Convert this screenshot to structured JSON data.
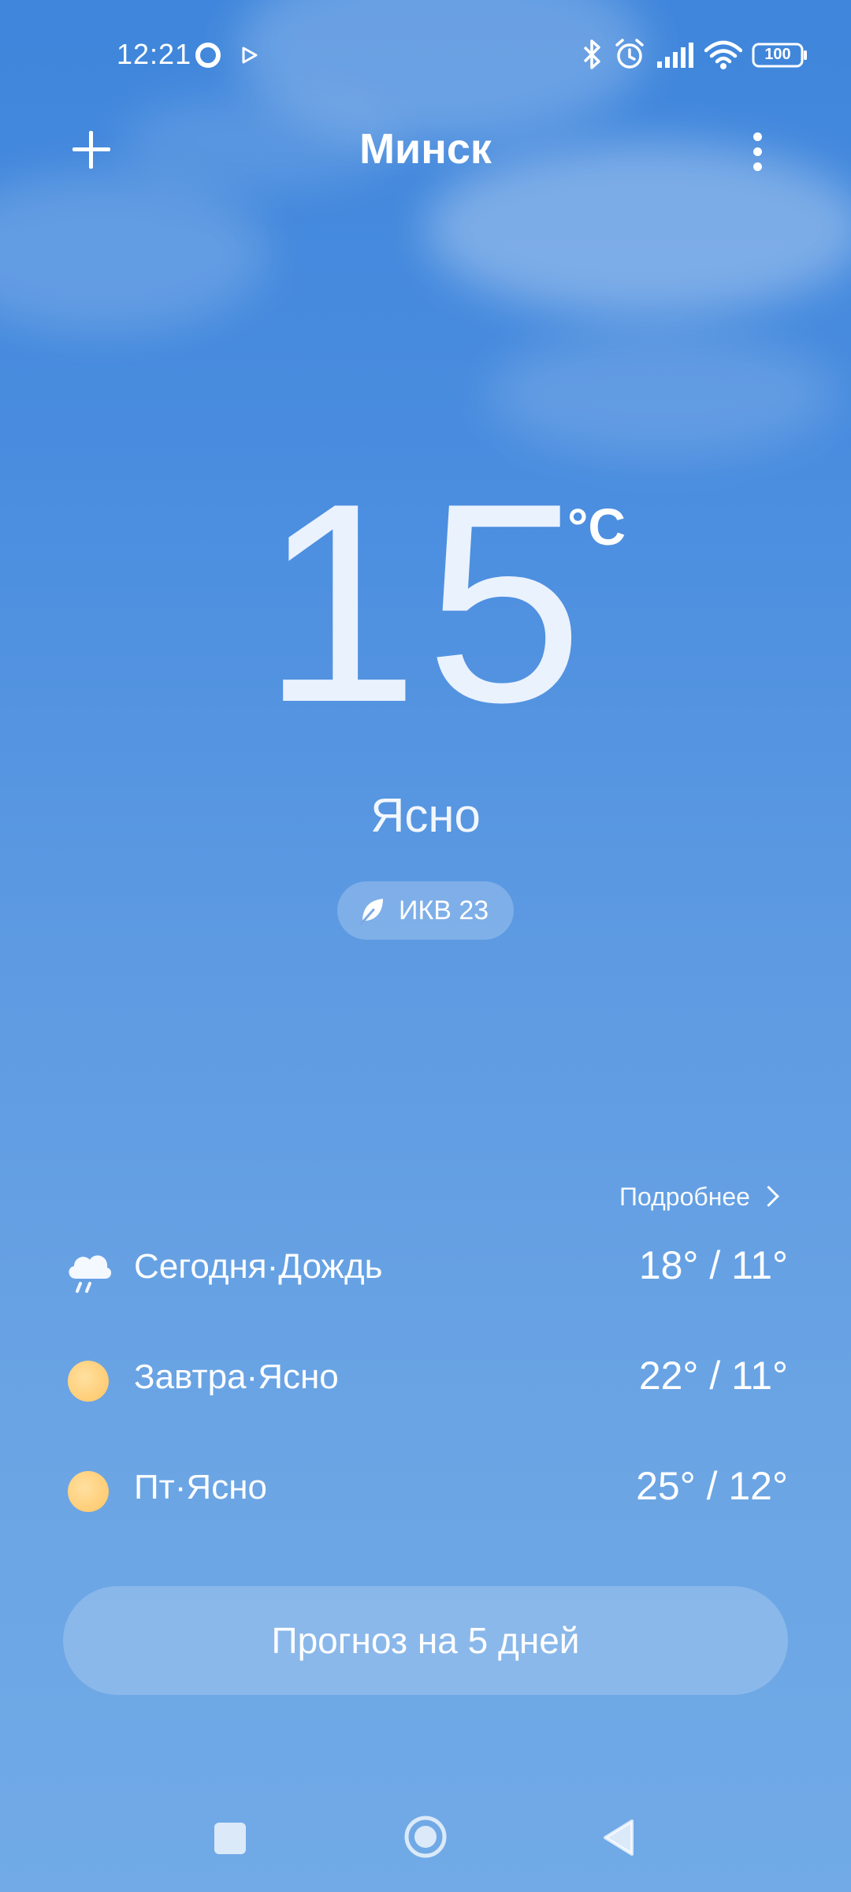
{
  "status_bar": {
    "time": "12:21",
    "battery": "100"
  },
  "header": {
    "city": "Минск"
  },
  "current": {
    "temperature": "15",
    "unit": "°C",
    "condition": "Ясно",
    "aqi_label": "ИКВ 23"
  },
  "forecast": {
    "more_label": "Подробнее",
    "days": [
      {
        "label": "Сегодня·Дождь",
        "temps": "18° / 11°",
        "icon": "rain-cloud-icon"
      },
      {
        "label": "Завтра·Ясно",
        "temps": "22° / 11°",
        "icon": "sun-icon"
      },
      {
        "label": "Пт·Ясно",
        "temps": "25° / 12°",
        "icon": "sun-icon"
      }
    ],
    "button_label": "Прогноз на 5 дней"
  },
  "colors": {
    "sky_top": "#3f86dc",
    "sky_bottom": "#71aae6",
    "sun": "#ffcd76"
  }
}
